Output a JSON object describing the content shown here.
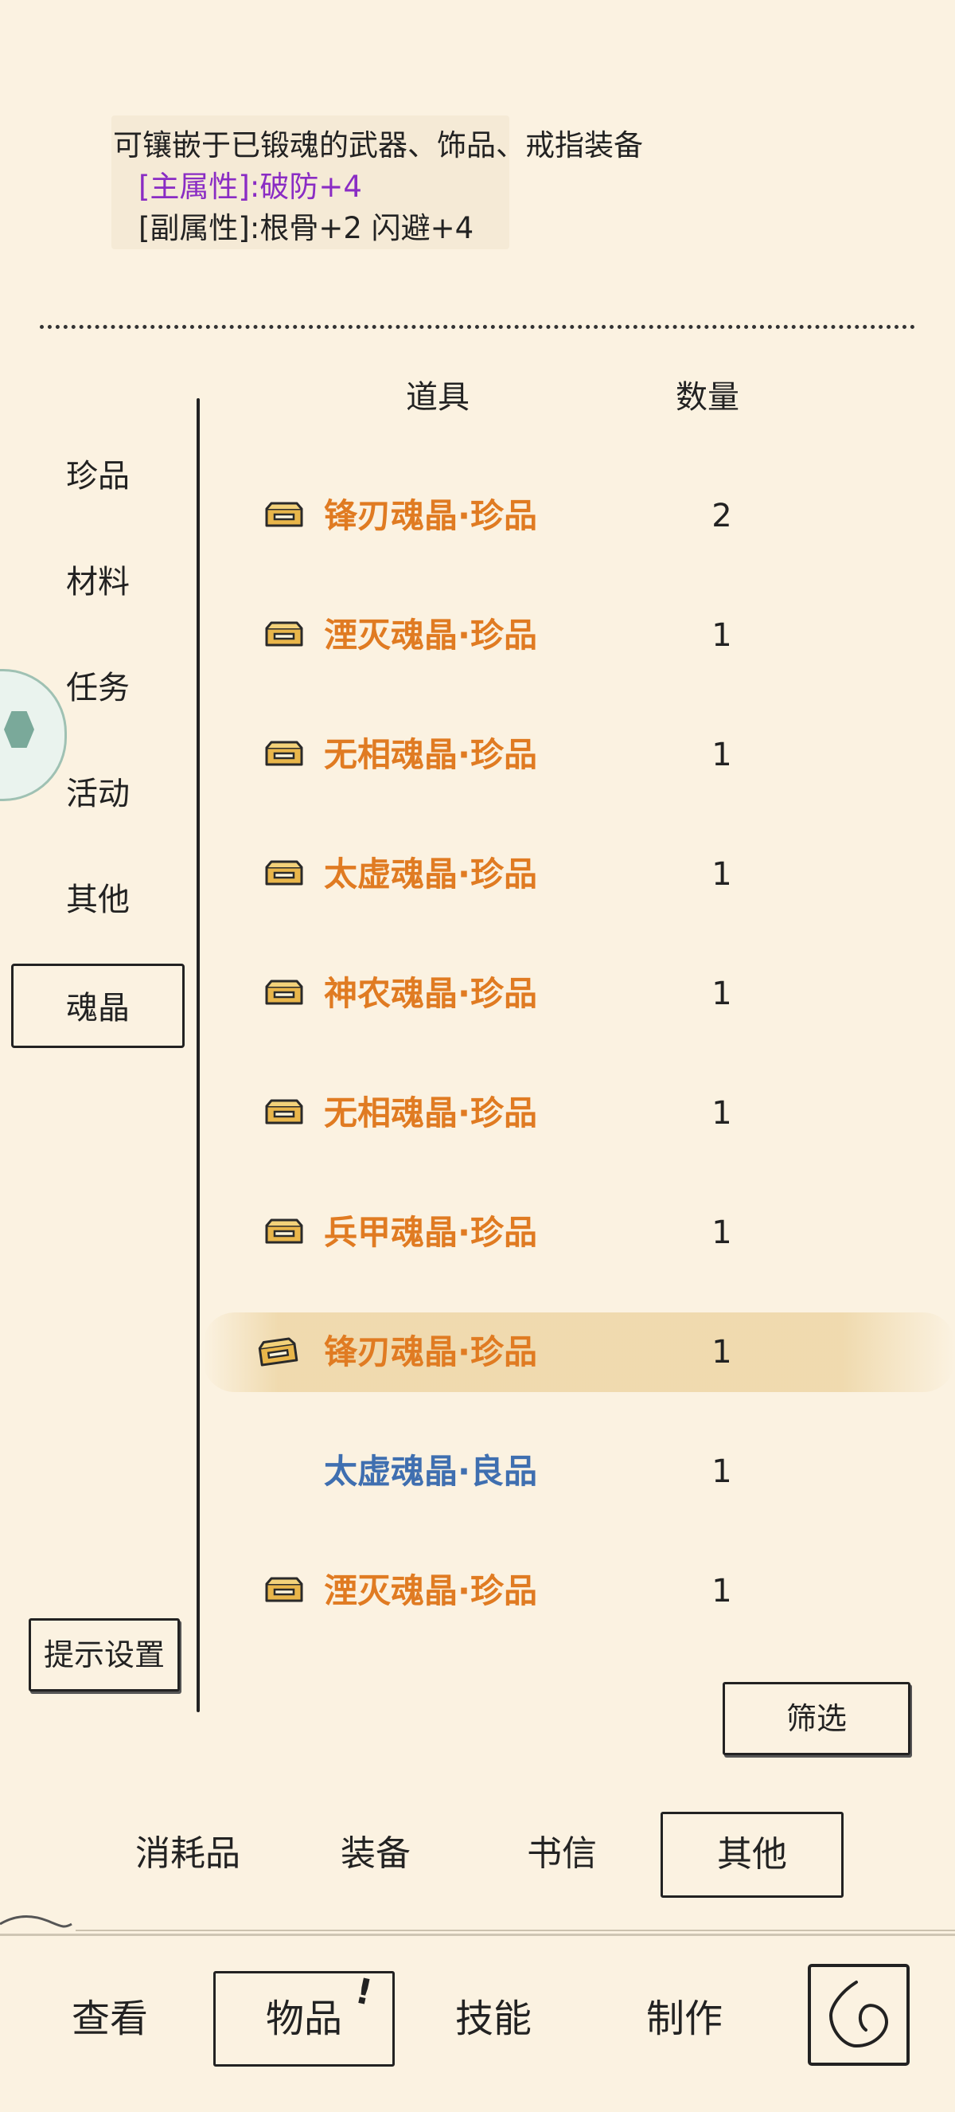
{
  "description": {
    "line1": "可镶嵌于已锻魂的武器、饰品、戒指装备",
    "main_attr": "[主属性]:破防+4",
    "sub_attr": "[副属性]:根骨+2 闪避+4"
  },
  "table_headers": {
    "item": "道具",
    "qty": "数量"
  },
  "side_tabs": [
    "珍品",
    "材料",
    "任务",
    "活动",
    "其他",
    "魂晶"
  ],
  "active_side_tab": "魂晶",
  "items": [
    {
      "name": "锋刃魂晶·珍品",
      "qty": "2",
      "quality": "rare"
    },
    {
      "name": "湮灭魂晶·珍品",
      "qty": "1",
      "quality": "rare"
    },
    {
      "name": "无相魂晶·珍品",
      "qty": "1",
      "quality": "rare"
    },
    {
      "name": "太虚魂晶·珍品",
      "qty": "1",
      "quality": "rare"
    },
    {
      "name": "神农魂晶·珍品",
      "qty": "1",
      "quality": "rare"
    },
    {
      "name": "无相魂晶·珍品",
      "qty": "1",
      "quality": "rare"
    },
    {
      "name": "兵甲魂晶·珍品",
      "qty": "1",
      "quality": "rare"
    },
    {
      "name": "锋刃魂晶·珍品",
      "qty": "1",
      "quality": "rare",
      "selected": true
    },
    {
      "name": "太虚魂晶·良品",
      "qty": "1",
      "quality": "good"
    },
    {
      "name": "湮灭魂晶·珍品",
      "qty": "1",
      "quality": "rare"
    }
  ],
  "buttons": {
    "tip_settings": "提示设置",
    "filter": "筛选"
  },
  "categories": [
    "消耗品",
    "装备",
    "书信",
    "其他"
  ],
  "active_category": "其他",
  "bottom_nav": [
    "查看",
    "物品",
    "技能",
    "制作"
  ],
  "active_nav": "物品",
  "nav_badge": "!",
  "colors": {
    "rare": "#e07b22",
    "good": "#3f6fb0",
    "main_attr": "#8a2cc4",
    "background": "#fbf2e1"
  },
  "icons": {
    "item": "chest-icon",
    "back": "back-arrow-icon",
    "side_handle": "floating-assistant-icon"
  }
}
